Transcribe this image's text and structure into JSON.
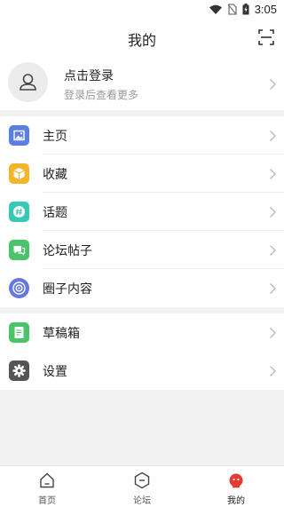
{
  "status_bar": {
    "time": "3:05"
  },
  "header": {
    "title": "我的",
    "scan_icon": "scan-icon"
  },
  "profile": {
    "title": "点击登录",
    "subtitle": "登录后查看更多",
    "avatar_icon": "user-icon"
  },
  "menu_group_1": [
    {
      "label": "主页",
      "icon": "image-icon",
      "color": "#5b7fe0"
    },
    {
      "label": "收藏",
      "icon": "box-icon",
      "color": "#f5b52b"
    },
    {
      "label": "话题",
      "icon": "hashtag-icon",
      "color": "#36c9b6"
    },
    {
      "label": "论坛帖子",
      "icon": "chat-icon",
      "color": "#4cc26a"
    },
    {
      "label": "圈子内容",
      "icon": "circle-icon",
      "color": "#6478de"
    }
  ],
  "menu_group_2": [
    {
      "label": "草稿箱",
      "icon": "document-icon",
      "color": "#4cc26a"
    }
  ],
  "menu_group_3": [
    {
      "label": "设置",
      "icon": "gear-icon",
      "color": "#555555"
    }
  ],
  "tabs": [
    {
      "label": "首页",
      "icon": "home-icon"
    },
    {
      "label": "论坛",
      "icon": "forum-icon"
    },
    {
      "label": "我的",
      "icon": "profile-icon",
      "active": true,
      "accent": "#e33b2f"
    }
  ]
}
